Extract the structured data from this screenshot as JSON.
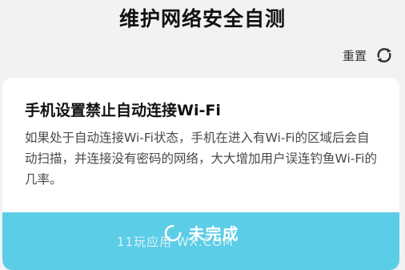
{
  "header": {
    "title": "维护网络安全自测"
  },
  "toolbar": {
    "reset_label": "重置",
    "reset_icon": "refresh-icon"
  },
  "card": {
    "title": "手机设置禁止自动连接Wi-Fi",
    "description": "如果处于自动连接Wi-Fi状态，手机在进入有Wi-Fi的区域后会自动扫描，并连接没有密码的网络，大大增加用户误连钓鱼Wi-Fi的几率。",
    "status_label": "未完成",
    "status_icon": "loading-circle-icon",
    "status_color": "#5ccde6"
  },
  "watermark": {
    "text": "11玩应用      WX.COM"
  }
}
